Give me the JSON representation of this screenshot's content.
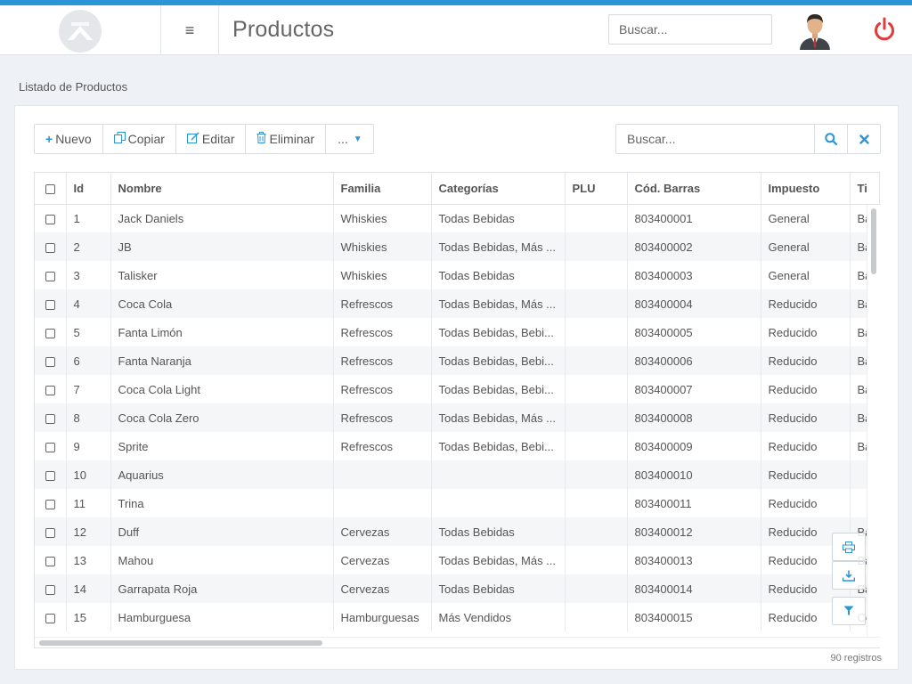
{
  "header": {
    "title": "Productos",
    "search_placeholder": "Buscar..."
  },
  "section_title": "Listado de Productos",
  "toolbar": {
    "nuevo": "Nuevo",
    "copiar": "Copiar",
    "editar": "Editar",
    "eliminar": "Eliminar",
    "more": "..."
  },
  "table_search_placeholder": "Buscar...",
  "columns": [
    "Id",
    "Nombre",
    "Familia",
    "Categorías",
    "PLU",
    "Cód. Barras",
    "Impuesto",
    "Ti"
  ],
  "rows": [
    {
      "id": "1",
      "nombre": "Jack Daniels",
      "familia": "Whiskies",
      "categorias": "Todas Bebidas",
      "plu": "",
      "cod": "803400001",
      "impuesto": "General",
      "ti": "Ba"
    },
    {
      "id": "2",
      "nombre": "JB",
      "familia": "Whiskies",
      "categorias": "Todas Bebidas, Más ...",
      "plu": "",
      "cod": "803400002",
      "impuesto": "General",
      "ti": "Ba"
    },
    {
      "id": "3",
      "nombre": "Talisker",
      "familia": "Whiskies",
      "categorias": "Todas Bebidas",
      "plu": "",
      "cod": "803400003",
      "impuesto": "General",
      "ti": "Ba"
    },
    {
      "id": "4",
      "nombre": "Coca Cola",
      "familia": "Refrescos",
      "categorias": "Todas Bebidas, Más ...",
      "plu": "",
      "cod": "803400004",
      "impuesto": "Reducido",
      "ti": "Ba"
    },
    {
      "id": "5",
      "nombre": "Fanta Limón",
      "familia": "Refrescos",
      "categorias": "Todas Bebidas, Bebi...",
      "plu": "",
      "cod": "803400005",
      "impuesto": "Reducido",
      "ti": "Ba"
    },
    {
      "id": "6",
      "nombre": "Fanta Naranja",
      "familia": "Refrescos",
      "categorias": "Todas Bebidas, Bebi...",
      "plu": "",
      "cod": "803400006",
      "impuesto": "Reducido",
      "ti": "Ba"
    },
    {
      "id": "7",
      "nombre": "Coca Cola Light",
      "familia": "Refrescos",
      "categorias": "Todas Bebidas, Bebi...",
      "plu": "",
      "cod": "803400007",
      "impuesto": "Reducido",
      "ti": "Ba"
    },
    {
      "id": "8",
      "nombre": "Coca Cola Zero",
      "familia": "Refrescos",
      "categorias": "Todas Bebidas, Más ...",
      "plu": "",
      "cod": "803400008",
      "impuesto": "Reducido",
      "ti": "Ba"
    },
    {
      "id": "9",
      "nombre": "Sprite",
      "familia": "Refrescos",
      "categorias": "Todas Bebidas, Bebi...",
      "plu": "",
      "cod": "803400009",
      "impuesto": "Reducido",
      "ti": "Ba"
    },
    {
      "id": "10",
      "nombre": "Aquarius",
      "familia": "",
      "categorias": "",
      "plu": "",
      "cod": "803400010",
      "impuesto": "Reducido",
      "ti": ""
    },
    {
      "id": "11",
      "nombre": "Trina",
      "familia": "",
      "categorias": "",
      "plu": "",
      "cod": "803400011",
      "impuesto": "Reducido",
      "ti": ""
    },
    {
      "id": "12",
      "nombre": "Duff",
      "familia": "Cervezas",
      "categorias": "Todas Bebidas",
      "plu": "",
      "cod": "803400012",
      "impuesto": "Reducido",
      "ti": "Ba"
    },
    {
      "id": "13",
      "nombre": "Mahou",
      "familia": "Cervezas",
      "categorias": "Todas Bebidas, Más ...",
      "plu": "",
      "cod": "803400013",
      "impuesto": "Reducido",
      "ti": "Ba"
    },
    {
      "id": "14",
      "nombre": "Garrapata Roja",
      "familia": "Cervezas",
      "categorias": "Todas Bebidas",
      "plu": "",
      "cod": "803400014",
      "impuesto": "Reducido",
      "ti": "Ba"
    },
    {
      "id": "15",
      "nombre": "Hamburguesa",
      "familia": "Hamburguesas",
      "categorias": "Más Vendidos",
      "plu": "",
      "cod": "803400015",
      "impuesto": "Reducido",
      "ti": "Co"
    }
  ],
  "records_label": "90 registros",
  "colors": {
    "accent": "#2b95d8",
    "power": "#e03a3a"
  }
}
